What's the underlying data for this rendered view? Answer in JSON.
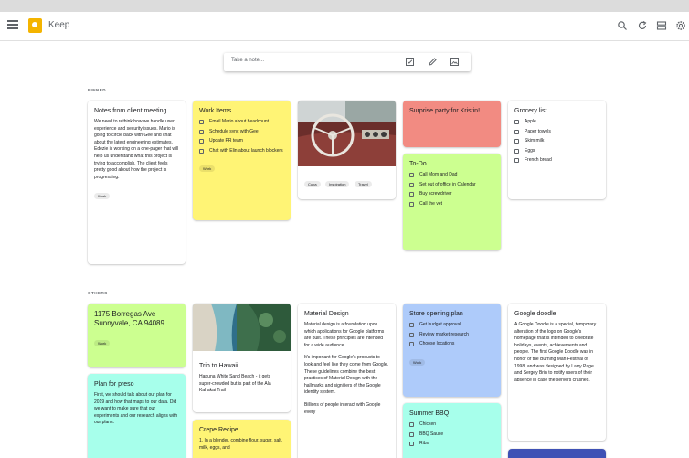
{
  "app": {
    "title": "Keep"
  },
  "icons": {
    "menu": "menu-icon",
    "logo": "keep-logo",
    "search": "search-icon",
    "refresh": "refresh-icon",
    "view": "list-view-icon",
    "settings": "gear-icon",
    "checklist": "checkbox-icon",
    "draw": "pencil-icon",
    "image": "image-icon"
  },
  "take_note": {
    "placeholder": "Take a note..."
  },
  "sections": {
    "pinned": "PINNED",
    "others": "OTHERS"
  },
  "pinned": {
    "client": {
      "title": "Notes from client meeting",
      "body": "We need to rethink how we handle user experience and security issues. Mario is going to circle back with Gee and chat about the latest engineering estimates. Edezie is working on a one-pager that will help us understand what this project is trying to accomplish. The client feels pretty good about how the project is progressing.",
      "chip": "Work"
    },
    "work": {
      "title": "Work Items",
      "items": [
        "Email Mario about headcount",
        "Schedule sync with Gee",
        "Update PR team",
        "Chat with Elin about launch blockers"
      ],
      "chip": "Work"
    },
    "car": {
      "chips": [
        "Cuba",
        "Inspiration",
        "Travel"
      ]
    },
    "surprise": {
      "title": "Surprise party for Kristin!"
    },
    "todo": {
      "title": "To-Do",
      "items": [
        "Call Mom and Dad",
        "Set out of office in Calendar",
        "Buy screwdriver",
        "Call the vet"
      ]
    },
    "grocery": {
      "title": "Grocery list",
      "items": [
        "Apple",
        "Paper towels",
        "Skim milk",
        "Eggs",
        "French bread"
      ]
    }
  },
  "others": {
    "address": {
      "title": "1175 Borregas Ave Sunnyvale, CA 94089",
      "chip": "Work"
    },
    "preso": {
      "title": "Plan for preso",
      "body": "First, we should talk about our plan for 2019 and how that maps to our data. Did we want to make sure that our experiments and our research aligns with our plans."
    },
    "hawaii": {
      "title": "Trip to Hawaii",
      "body": "Hapuna White Sand Beach - it gets super-crowded but is part of the Ala Kahakai Trail"
    },
    "crepe": {
      "title": "Crepe Recipe",
      "body": "1. In a blender, combine flour, sugar, salt, milk, eggs, and"
    },
    "material": {
      "title": "Material Design",
      "body1": "Material design is a foundation upon which applications for Google platforms are built. These principles are intended for a wide audience.",
      "body2": "It's important for Google's products to look and feel like they come from Google. These guidelines combine the best practices of Material Design with the hallmarks and signifiers of the Google identity system.",
      "body3": "Billions of people interact with Google every"
    },
    "store": {
      "title": "Store opening plan",
      "items": [
        "Get budget approval",
        "Review market research",
        "Choose locations"
      ],
      "chip": "Work"
    },
    "bbq": {
      "title": "Summer BBQ",
      "items": [
        "Chicken",
        "BBQ Sauce",
        "Ribs"
      ]
    },
    "doodle": {
      "title": "Google doodle",
      "body": "A Google Doodle is a special, temporary alteration of the logo on Google's homepage that is intended to celebrate holidays, events, achievements and people. The first Google Doodle was in honor of the Burning Man Festival of 1998, and was designed by Larry Page and Sergey Brin to notify users of their absence in case the servers crashed."
    }
  }
}
